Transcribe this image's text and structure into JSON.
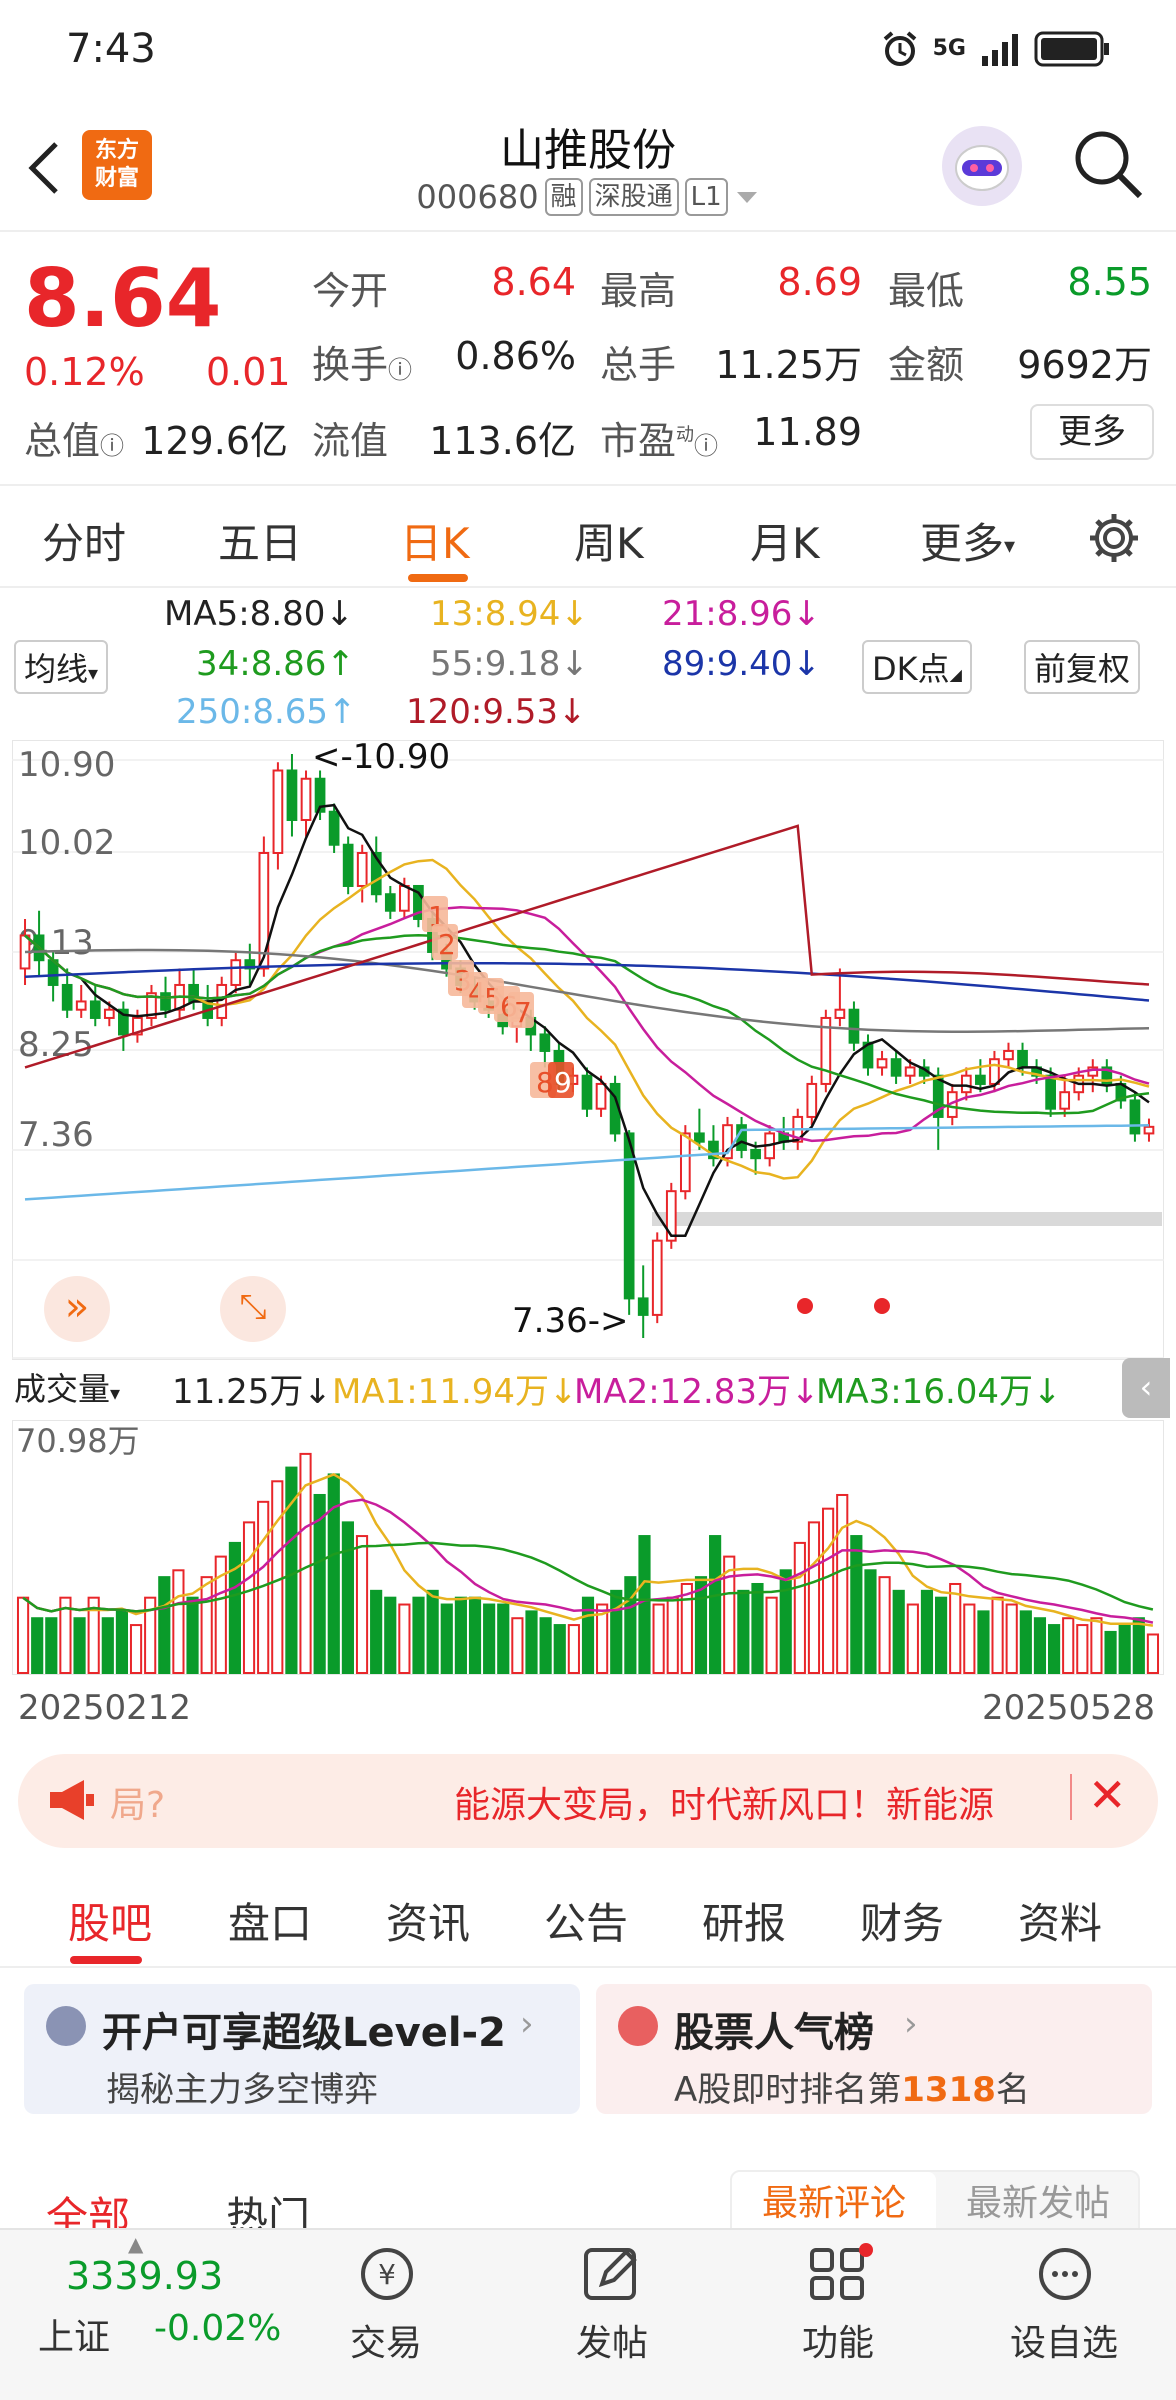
{
  "status": {
    "time": "7:43",
    "network": "5G"
  },
  "header": {
    "title": "山推股份",
    "code": "000680",
    "tags": [
      "融",
      "深股通",
      "L1"
    ],
    "badge": "东方\n财富"
  },
  "quote": {
    "price": "8.64",
    "pct": "0.12%",
    "change": "0.01",
    "open_label": "今开",
    "open": "8.64",
    "high_label": "最高",
    "high": "8.69",
    "low_label": "最低",
    "low": "8.55",
    "turnover_label": "换手",
    "turnover": "0.86%",
    "volume_label": "总手",
    "volume": "11.25万",
    "amount_label": "金额",
    "amount": "9692万",
    "mcap_label": "总值",
    "mcap": "129.6亿",
    "float_label": "流值",
    "float": "113.6亿",
    "pe_label": "市盈",
    "pe_sup": "动",
    "pe": "11.89",
    "more": "更多"
  },
  "period_tabs": [
    "分时",
    "五日",
    "日K",
    "周K",
    "月K",
    "更多"
  ],
  "ma": {
    "select": "均线",
    "ma5": "MA5:8.80↓",
    "ma13": "13:8.94↓",
    "ma21": "21:8.96↓",
    "ma34": "34:8.86↑",
    "ma55": "55:9.18↓",
    "ma89": "89:9.40↓",
    "ma250": "250:8.65↑",
    "ma120": "120:9.53↓",
    "dk": "DK点",
    "adjust": "前复权"
  },
  "chart": {
    "y_ticks": [
      "10.90",
      "10.02",
      "9.13",
      "8.25",
      "7.36"
    ],
    "high_marker": "<-10.90",
    "low_marker": "7.36->",
    "dk_labels": [
      "1",
      "2",
      "3",
      "4",
      "5",
      "6",
      "7",
      "8",
      "9"
    ],
    "colors": {
      "up": "#e8262a",
      "down": "#0a9b2a",
      "ma5": "#111111",
      "ma13": "#e8b320",
      "ma21": "#c81e9c",
      "ma34": "#1f9b1f",
      "ma55": "#777777",
      "ma89": "#1b35a8",
      "ma250": "#6bb8e8",
      "ma120": "#b01b28"
    }
  },
  "volume": {
    "select": "成交量",
    "vol": "11.25万↓",
    "ma1": "MA1:11.94万↓",
    "ma2": "MA2:12.83万↓",
    "ma3": "MA3:16.04万↓",
    "max_label": "70.98万",
    "date_start": "20250212",
    "date_end": "20250528"
  },
  "banner": {
    "left": "局?",
    "text": "能源大变局，时代新风口！新能源"
  },
  "section_tabs": [
    "股吧",
    "盘口",
    "资讯",
    "公告",
    "研报",
    "财务",
    "资料"
  ],
  "cards": [
    {
      "title": "开户可享超级Level-2",
      "sub": "揭秘主力多空博弈"
    },
    {
      "title": "股票人气榜",
      "sub_pre": "A股即时排名第",
      "rank": "1318",
      "sub_post": "名"
    }
  ],
  "feed_tabs": [
    "全部",
    "热门"
  ],
  "feed_sort": [
    "最新评论",
    "最新发帖"
  ],
  "nav": {
    "index_value": "3339.93",
    "index_name": "上证",
    "index_change": "-0.02%",
    "items": [
      "交易",
      "发帖",
      "功能",
      "设自选"
    ]
  }
}
